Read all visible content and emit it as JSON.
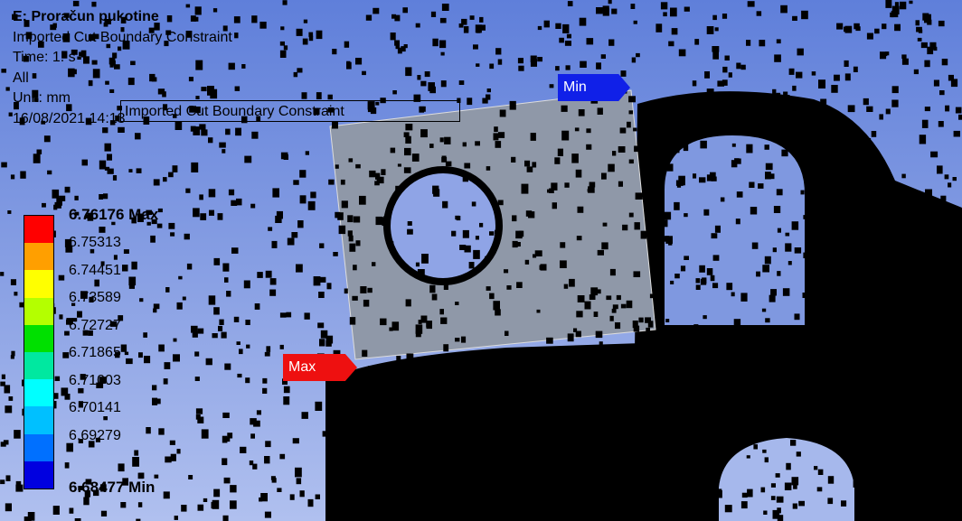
{
  "info": {
    "title": "E: Proračun pukotine",
    "subtitle": "Imported Cut Boundary Constraint",
    "time": "Time: 1. s",
    "all": "All",
    "unit": "Unit: mm",
    "datetime": "16/08/2021 14:13"
  },
  "callout_label": "Imported Cut Boundary Constraint",
  "legend": {
    "max_label": "6.76176 Max",
    "min_label": "6.68477 Min",
    "ticks": [
      "6.75313",
      "6.74451",
      "6.73589",
      "6.72727",
      "6.71865",
      "6.71003",
      "6.70141",
      "6.69279"
    ],
    "colors": [
      "#ff0000",
      "#ff9f00",
      "#ffff00",
      "#b4ff00",
      "#00e000",
      "#00e8a0",
      "#00ffff",
      "#00c0ff",
      "#0070ff",
      "#0000e0"
    ]
  },
  "probes": {
    "min_label": "Min",
    "max_label": "Max"
  },
  "colors": {
    "background_top": "#5f7fda",
    "plate": "#8f98a8",
    "particles": "#000000"
  }
}
